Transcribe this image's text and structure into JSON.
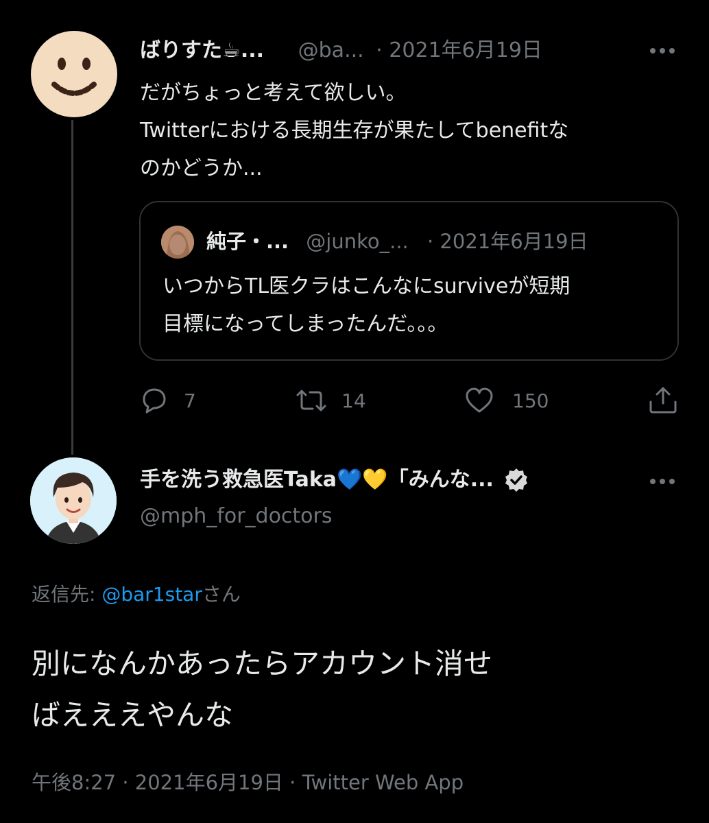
{
  "parent_tweet": {
    "display_name": "ばりすた☕...",
    "handle": "@ba...",
    "date": "· 2021年6月19日",
    "text_lines": [
      "だがちょっと考えて欲しい。",
      "Twitterにおける長期生存が果たしてbenefitな",
      "のかどうか..."
    ],
    "quoted": {
      "display_name": "純子・...",
      "handle": "@junko_...",
      "date": "· 2021年6月19日",
      "text_lines": [
        "いつからTL医クラはこんなにsurviveが短期",
        "目標になってしまったんだ。。。"
      ]
    },
    "actions": {
      "reply_count": "7",
      "retweet_count": "14",
      "like_count": "150"
    }
  },
  "main_tweet": {
    "display_name": "手を洗う救急医Taka💙💛「みんな...",
    "handle": "@mph_for_doctors",
    "reply_prefix": "返信先: ",
    "reply_to": "@bar1star",
    "reply_suffix": "さん",
    "text_lines": [
      "別になんかあったらアカウント消せ",
      "ばえええやんな"
    ],
    "timestamp": "午後8:27 · 2021年6月19日 · Twitter Web App"
  },
  "colors": {
    "background": "#000000",
    "text": "#e7e9ea",
    "muted": "#71767b",
    "link": "#1d9bf0"
  }
}
